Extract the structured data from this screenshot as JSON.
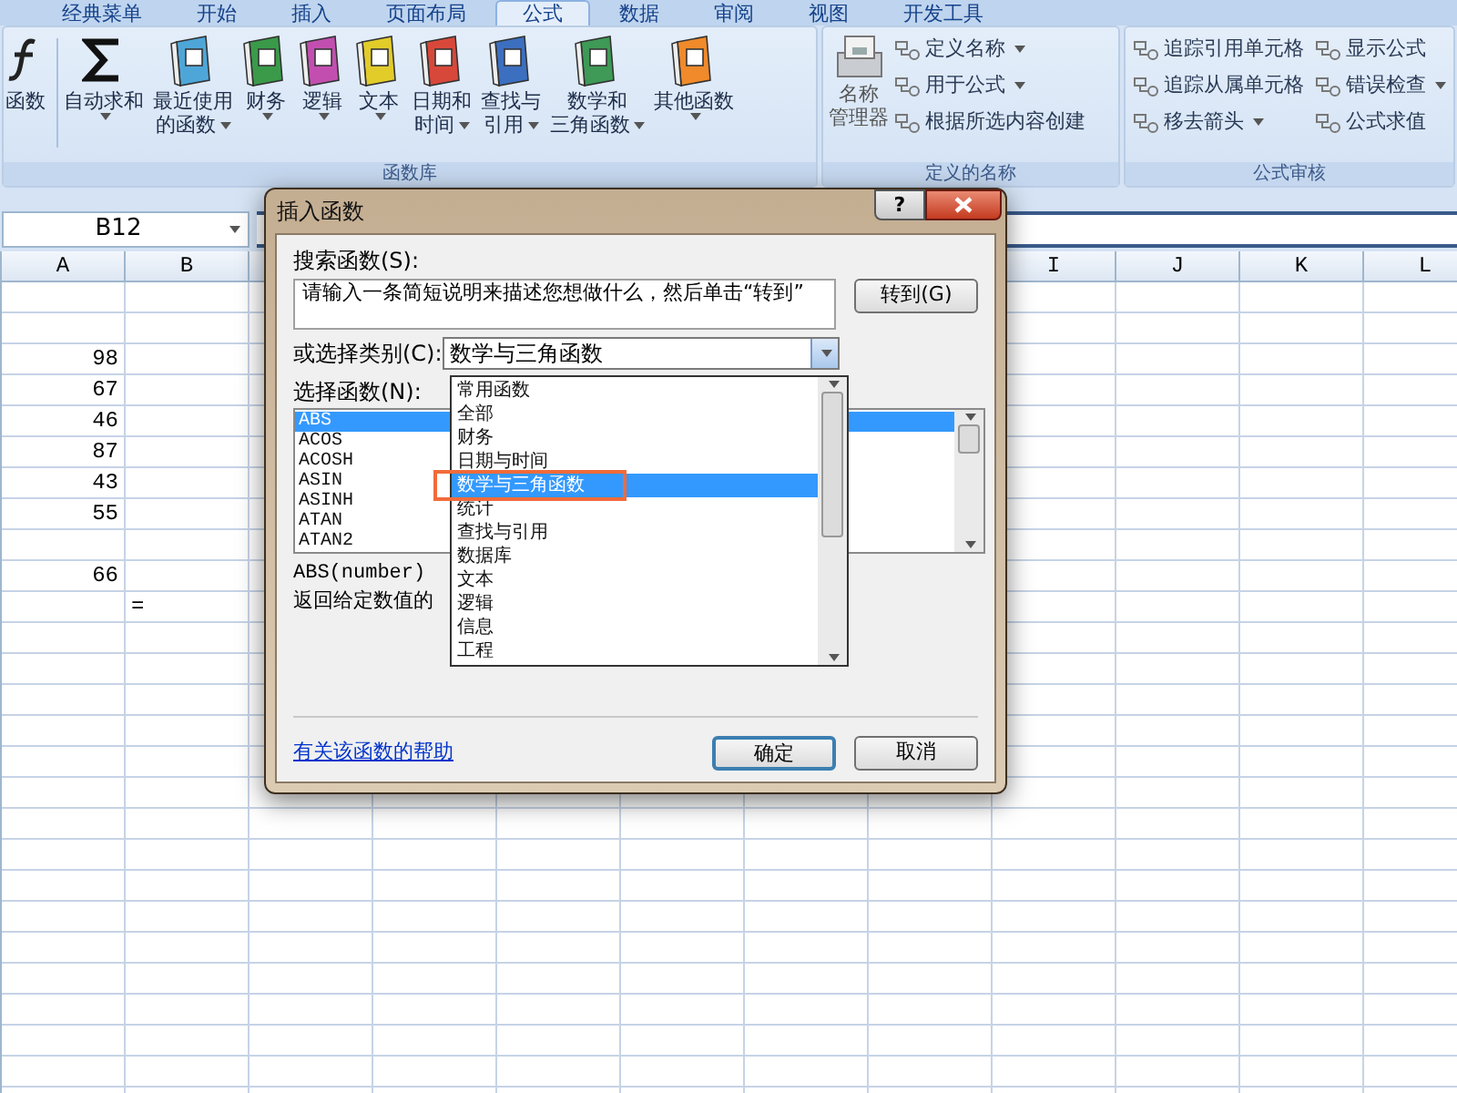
{
  "ribbon_tabs": [
    {
      "label": "经典菜单",
      "selected": false
    },
    {
      "label": "开始",
      "selected": false
    },
    {
      "label": "插入",
      "selected": false
    },
    {
      "label": "页面布局",
      "selected": false
    },
    {
      "label": "公式",
      "selected": true
    },
    {
      "label": "数据",
      "selected": false
    },
    {
      "label": "审阅",
      "selected": false
    },
    {
      "label": "视图",
      "selected": false
    },
    {
      "label": "开发工具",
      "selected": false
    }
  ],
  "function_library": {
    "label": "函数库",
    "buttons": [
      {
        "lines": [
          "函数"
        ],
        "dropdown": false
      },
      {
        "lines": [
          "自动求和"
        ],
        "dropdown": true
      },
      {
        "lines": [
          "最近使用",
          "的函数"
        ],
        "dropdown": true
      },
      {
        "lines": [
          "财务"
        ],
        "dropdown": true
      },
      {
        "lines": [
          "逻辑"
        ],
        "dropdown": true
      },
      {
        "lines": [
          "文本"
        ],
        "dropdown": true
      },
      {
        "lines": [
          "日期和",
          "时间"
        ],
        "dropdown": true
      },
      {
        "lines": [
          "查找与",
          "引用"
        ],
        "dropdown": true
      },
      {
        "lines": [
          "数学和",
          "三角函数"
        ],
        "dropdown": true
      },
      {
        "lines": [
          "其他函数"
        ],
        "dropdown": true
      }
    ]
  },
  "defined_names": {
    "label": "定义的名称",
    "manager": [
      "名称",
      "管理器"
    ],
    "items": [
      {
        "label": "定义名称",
        "dropdown": true
      },
      {
        "label": "用于公式",
        "dropdown": true
      },
      {
        "label": "根据所选内容创建",
        "dropdown": false
      }
    ]
  },
  "formula_auditing": {
    "label": "公式审核",
    "columns": [
      [
        {
          "label": "追踪引用单元格",
          "dropdown": false
        },
        {
          "label": "追踪从属单元格",
          "dropdown": false
        },
        {
          "label": "移去箭头",
          "dropdown": true
        }
      ],
      [
        {
          "label": "显示公式",
          "dropdown": false
        },
        {
          "label": "错误检查",
          "dropdown": true
        },
        {
          "label": "公式求值",
          "dropdown": false
        }
      ]
    ]
  },
  "name_box": "B12",
  "sheet": {
    "columns": [
      "A",
      "B",
      "I",
      "J",
      "K",
      "L"
    ],
    "rows": [
      [
        null,
        null
      ],
      [
        null,
        null
      ],
      [
        "98",
        null
      ],
      [
        "67",
        null
      ],
      [
        "46",
        null
      ],
      [
        "87",
        null
      ],
      [
        "43",
        null
      ],
      [
        "55",
        null
      ],
      [
        null,
        null
      ],
      [
        "66",
        null
      ],
      [
        null,
        "="
      ]
    ]
  },
  "dialog": {
    "title": "插入函数",
    "help_button": "?",
    "search_label": "搜索函数(S):",
    "search_value": "请输入一条简短说明来描述您想做什么，然后单击“转到”",
    "go_button": "转到(G)",
    "category_label": "或选择类别(C):",
    "category_value": "数学与三角函数",
    "function_label": "选择函数(N):",
    "functions": [
      {
        "name": "ABS",
        "selected": true
      },
      {
        "name": "ACOS",
        "selected": false
      },
      {
        "name": "ACOSH",
        "selected": false
      },
      {
        "name": "ASIN",
        "selected": false
      },
      {
        "name": "ASINH",
        "selected": false
      },
      {
        "name": "ATAN",
        "selected": false
      },
      {
        "name": "ATAN2",
        "selected": false
      }
    ],
    "signature": "ABS(number)",
    "description": "返回给定数值的",
    "help_link": "有关该函数的帮助",
    "ok_button": "确定",
    "cancel_button": "取消",
    "category_options": [
      {
        "label": "常用函数",
        "selected": false
      },
      {
        "label": "全部",
        "selected": false
      },
      {
        "label": "财务",
        "selected": false
      },
      {
        "label": "日期与时间",
        "selected": false
      },
      {
        "label": "数学与三角函数",
        "selected": true
      },
      {
        "label": "统计",
        "selected": false
      },
      {
        "label": "查找与引用",
        "selected": false
      },
      {
        "label": "数据库",
        "selected": false
      },
      {
        "label": "文本",
        "selected": false
      },
      {
        "label": "逻辑",
        "selected": false
      },
      {
        "label": "信息",
        "selected": false
      },
      {
        "label": "工程",
        "selected": false
      }
    ]
  }
}
